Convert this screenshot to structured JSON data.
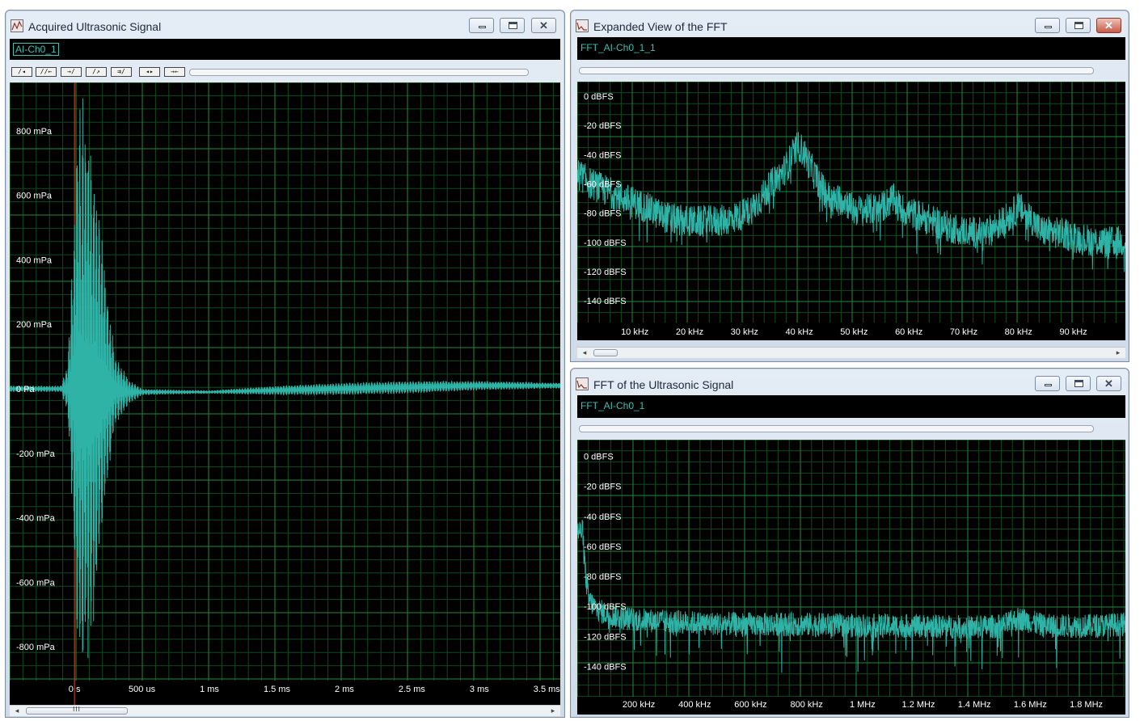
{
  "windows": {
    "acquired": {
      "title": "Acquired Ultrasonic Signal",
      "channel": "AI-Ch0_1",
      "toolbar": [
        "/◂",
        "//←",
        "→/",
        "/↗",
        "⇉/",
        "◂▸",
        "→←"
      ],
      "scroll_grip": "III"
    },
    "expanded": {
      "title": "Expanded View of the FFT",
      "channel": "FFT_AI-Ch0_1_1"
    },
    "fft": {
      "title": "FFT of the Ultrasonic Signal",
      "channel": "FFT_AI-Ch0_1"
    }
  },
  "colors": {
    "trace": "#2fb3a6",
    "grid": "#1f8a3a",
    "grid_minor": "#0f4a1e",
    "plot_bg": "#000000",
    "cursor": "#d9482b"
  },
  "icons": {
    "app": "chart-window-icon",
    "minimize": "minimize-icon",
    "maximize": "maximize-icon",
    "close": "close-icon"
  },
  "chart_data": [
    {
      "type": "line",
      "window": "acquired",
      "y_tick_labels": [
        "800 mPa",
        "600 mPa",
        "400 mPa",
        "200 mPa",
        "0 Pa",
        "-200 mPa",
        "-400 mPa",
        "-600 mPa",
        "-800 mPa"
      ],
      "y_tick_values": [
        0.8,
        0.6,
        0.4,
        0.2,
        0,
        -0.2,
        -0.4,
        -0.6,
        -0.8
      ],
      "x_tick_labels": [
        "0 s",
        "500 us",
        "1 ms",
        "1.5 ms",
        "2 ms",
        "2.5 ms",
        "3 ms",
        "3.5 ms"
      ],
      "x_tick_values": [
        0,
        0.0005,
        0.001,
        0.0015,
        0.002,
        0.0025,
        0.003,
        0.0035
      ],
      "xlim": [
        -0.00048,
        0.0036
      ],
      "ylim": [
        -0.98,
        0.95
      ],
      "series": [
        {
          "x": [
            -0.00048,
            -0.0001,
            -5e-05,
            0,
            3e-05,
            6e-05,
            0.0001,
            0.00015,
            0.0002,
            0.00025,
            0.0003,
            0.0004,
            0.0005,
            0.001,
            0.0015,
            0.002,
            0.0025,
            0.003,
            0.0035,
            0.0036
          ],
          "envelope": [
            0.01,
            0.01,
            0.08,
            0.55,
            0.88,
            0.91,
            0.88,
            0.72,
            0.5,
            0.3,
            0.12,
            0.04,
            0.01,
            0.005,
            0.015,
            0.02,
            0.02,
            0.015,
            0.01,
            0.01
          ],
          "offset": [
            0,
            0,
            0,
            0,
            0,
            0,
            0,
            0,
            0,
            0,
            0,
            -0.01,
            -0.01,
            -0.01,
            -0.005,
            0.0,
            0.005,
            0.01,
            0.01,
            0.01
          ]
        }
      ],
      "grid": true
    },
    {
      "type": "line",
      "window": "expanded",
      "y_tick_labels": [
        "0 dBFS",
        "-20 dBFS",
        "-40 dBFS",
        "-60 dBFS",
        "-80 dBFS",
        "-100 dBFS",
        "-120 dBFS",
        "-140 dBFS"
      ],
      "y_tick_values": [
        0,
        -20,
        -40,
        -60,
        -80,
        -100,
        -120,
        -140
      ],
      "x_tick_labels": [
        "10 kHz",
        "20 kHz",
        "30 kHz",
        "40 kHz",
        "50 kHz",
        "60 kHz",
        "70 kHz",
        "80 kHz",
        "90 kHz"
      ],
      "x_tick_values": [
        10,
        20,
        30,
        40,
        50,
        60,
        70,
        80,
        90
      ],
      "xlim": [
        -0.5,
        99.5
      ],
      "ylim": [
        -167,
        10
      ],
      "series": [
        {
          "x": [
            0,
            2,
            5,
            8,
            10,
            12,
            15,
            18,
            22,
            26,
            29,
            31,
            33,
            35,
            37,
            38,
            39,
            40,
            41,
            42,
            44,
            46,
            48,
            50,
            52,
            55,
            57,
            59,
            62,
            66,
            70,
            74,
            77,
            79,
            80,
            82,
            84,
            88,
            92,
            96,
            99.5
          ],
          "y": [
            -54,
            -60,
            -65,
            -70,
            -73,
            -76,
            -82,
            -85,
            -86,
            -85,
            -82,
            -78,
            -70,
            -60,
            -52,
            -46,
            -38,
            -34,
            -40,
            -48,
            -62,
            -72,
            -70,
            -78,
            -78,
            -76,
            -70,
            -78,
            -82,
            -88,
            -92,
            -94,
            -86,
            -80,
            -76,
            -82,
            -92,
            -94,
            -98,
            -100,
            -99
          ]
        }
      ],
      "grid": true
    },
    {
      "type": "line",
      "window": "fft",
      "y_tick_labels": [
        "0 dBFS",
        "-20 dBFS",
        "-40 dBFS",
        "-60 dBFS",
        "-80 dBFS",
        "-100 dBFS",
        "-120 dBFS",
        "-140 dBFS"
      ],
      "y_tick_values": [
        0,
        -20,
        -40,
        -60,
        -80,
        -100,
        -120,
        -140
      ],
      "x_tick_labels": [
        "200 kHz",
        "400 kHz",
        "600 kHz",
        "800 kHz",
        "1 MHz",
        "1.2 MHz",
        "1.4 MHz",
        "1.6 MHz",
        "1.8 MHz"
      ],
      "x_tick_values": [
        200,
        400,
        600,
        800,
        1000,
        1200,
        1400,
        1600,
        1800
      ],
      "xlim": [
        -20,
        1940
      ],
      "ylim": [
        -172,
        11
      ],
      "series": [
        {
          "x": [
            0,
            10,
            20,
            40,
            60,
            100,
            150,
            200,
            400,
            600,
            800,
            1000,
            1200,
            1400,
            1500,
            1560,
            1600,
            1650,
            1800,
            1940
          ],
          "y": [
            -50,
            -80,
            -95,
            -100,
            -103,
            -106,
            -108,
            -109,
            -111,
            -112,
            -112,
            -113,
            -113,
            -114,
            -113,
            -108,
            -110,
            -113,
            -113,
            -112
          ]
        }
      ],
      "grid": true
    }
  ]
}
